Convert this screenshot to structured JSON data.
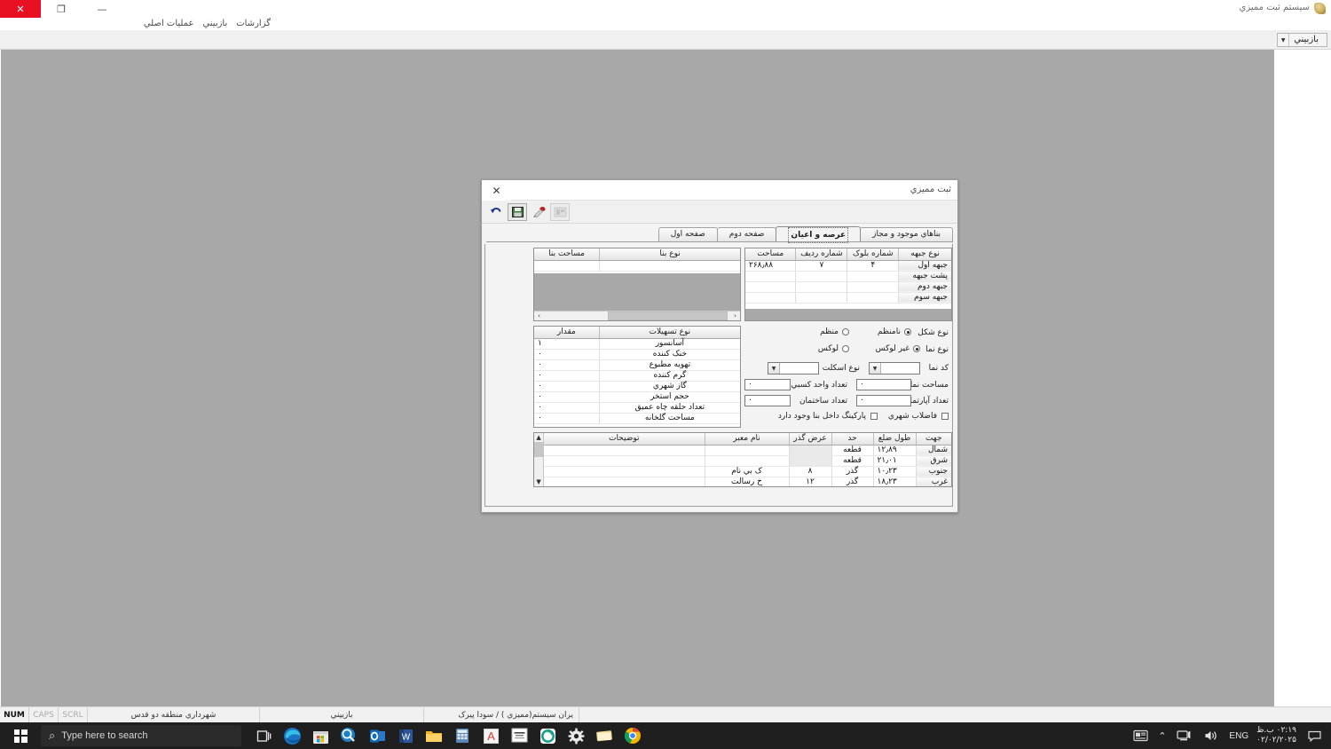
{
  "app": {
    "title": "سیستم ثبت ممیزي",
    "icon": "app-icon",
    "window_controls": {
      "minimize": "—",
      "maximize": "❐",
      "close": "✕"
    },
    "menu": [
      "گزارشات",
      "بازبيني",
      "عملیات اصلي"
    ],
    "toolbar": {
      "button_label": "بازبيني",
      "caret": "▼"
    }
  },
  "dialog": {
    "title": "ثبت ممیزي",
    "close": "✕",
    "toolbar": [
      {
        "name": "undo-icon",
        "glyph": "↶"
      },
      {
        "name": "save-icon",
        "glyph": "💾"
      },
      {
        "name": "edit-stamp-icon",
        "glyph": "✎"
      },
      {
        "name": "preview-icon",
        "glyph": "▦"
      }
    ],
    "tabs": [
      {
        "label": "بناهاي موجود و مجاز",
        "active": false
      },
      {
        "label": "عرصه و اعیان",
        "active": true
      },
      {
        "label": "صفحه دوم",
        "active": false
      },
      {
        "label": "صفحه اول",
        "active": false
      }
    ],
    "building_grid": {
      "headers": [
        "نوع بنا",
        "مساحت بنا"
      ],
      "rows": [
        [
          "",
          ""
        ]
      ],
      "scroll": {
        "left_arrow": "‹",
        "right_arrow": "›"
      }
    },
    "front_grid": {
      "headers": [
        "نوع جبهه",
        "شماره بلوک",
        "شماره ردیف",
        "مساحت"
      ],
      "rows": [
        [
          "جبهه اول",
          "۴",
          "۷",
          "۲۶۸٫۸۸"
        ],
        [
          "پشت جبهه",
          "",
          "",
          ""
        ],
        [
          "جبهه دوم",
          "",
          "",
          ""
        ],
        [
          "جبهه سوم",
          "",
          "",
          ""
        ]
      ]
    },
    "facilities_grid": {
      "headers": [
        "نوع تسهیلات",
        "مقدار"
      ],
      "rows": [
        [
          "آسانسور",
          "۱"
        ],
        [
          "خنک کننده",
          "۰"
        ],
        [
          "تهویه مطبوع",
          "۰"
        ],
        [
          "گرم کننده",
          "۰"
        ],
        [
          "گاز شهري",
          "۰"
        ],
        [
          "حجم استخر",
          "۰"
        ],
        [
          "تعداد حلقه چاه عمیق",
          "۰"
        ],
        [
          "مساحت گلخانه",
          "۰"
        ]
      ]
    },
    "form": {
      "shape_label": "نوع شکل",
      "shape_option_irregular": "نامنظم",
      "shape_option_regular": "منظم",
      "facade_label": "نوع نما",
      "facade_option_nonluxury": "غیر لوکس",
      "facade_option_luxury": "لوکس",
      "facade_code_label": "کد نما",
      "facade_code_value": "",
      "skeleton_label": "نوع اسکلت",
      "skeleton_value": "",
      "facade_area_label": "مساحت نما",
      "facade_area_value": "۰",
      "business_units_label": "تعداد واحد کسبي",
      "business_units_value": "۰",
      "apartments_label": "تعداد آپارتمان",
      "apartments_value": "۰",
      "buildings_label": "تعداد ساختمان",
      "buildings_value": "۰",
      "sewage_label": "فاضلاب شهري",
      "parking_label": "پارکینگ داخل بنا وجود دارد",
      "combo_caret": "▼"
    },
    "boundary_grid": {
      "headers": [
        "جهت",
        "طول ضلع",
        "حد",
        "عرض گذر",
        "نام معبر",
        "توضیحات"
      ],
      "rows": [
        [
          "شمال",
          "۱۲٫۸۹",
          "قطعه",
          "",
          "",
          ""
        ],
        [
          "شرق",
          "۲۱٫۰۱",
          "قطعه",
          "",
          "",
          ""
        ],
        [
          "جنوب",
          "۱۰٫۲۳",
          "گذر",
          "۸",
          "ک بي نام",
          ""
        ],
        [
          "غرب",
          "۱۸٫۲۳",
          "گذر",
          "۱۲",
          "خ رسالت",
          ""
        ]
      ],
      "scroll": {
        "up_arrow": "▲",
        "down_arrow": "▼"
      }
    }
  },
  "statusbar": {
    "num": "NUM",
    "caps": "CAPS",
    "scrl": "SCRL",
    "municipality": "شهرداري منطقه دو قدس",
    "mode": "بازبيني",
    "vendor": "یران سیستم(ممیزي ) / سودا پیرک"
  },
  "taskbar": {
    "search_placeholder": "Type here to search",
    "search_icon": "⌕",
    "task_view_icon": "task-view-icon",
    "apps": [
      {
        "name": "edge-icon",
        "glyph": "e",
        "color": "#1a7fd4"
      },
      {
        "name": "microsoft-store-icon",
        "glyph": "▤",
        "color": "#e8e8e8"
      },
      {
        "name": "search-app-icon",
        "glyph": "🔍",
        "color": "#1f7fc4"
      },
      {
        "name": "outlook-icon",
        "glyph": "O",
        "color": "#0f6cbd"
      },
      {
        "name": "word-icon",
        "glyph": "W",
        "color": "#2b579a"
      },
      {
        "name": "file-explorer-icon",
        "glyph": "▭",
        "color": "#f0b429"
      },
      {
        "name": "excel-calculator-icon",
        "glyph": "▦",
        "color": "#4d7fb3"
      },
      {
        "name": "autocad-icon",
        "glyph": "A",
        "color": "#d73b35"
      },
      {
        "name": "persian-app-icon",
        "glyph": "▤",
        "color": "#ffffff"
      },
      {
        "name": "teams-like-icon",
        "glyph": "◉",
        "color": "#1c9c8a"
      },
      {
        "name": "settings-gear-icon",
        "glyph": "⚙",
        "color": "#e6e6e6"
      },
      {
        "name": "sticky-notes-icon",
        "glyph": "▱",
        "color": "#e8c468"
      },
      {
        "name": "chrome-icon",
        "glyph": "◎",
        "color": "#4caf50"
      }
    ],
    "tray": {
      "news_icon": "news-icon",
      "chevron": "⌃",
      "network_icon": "🖳",
      "volume_icon": "🔊",
      "language": "ENG",
      "time": "۰۲:۱۹ ب.ظ",
      "date": "۰۲/۰۲/۲۰۲۵",
      "notification_icon": "▭"
    }
  },
  "colors": {
    "desktop_gray": "#a8a8a8",
    "dialog_face": "#f3f3f3",
    "taskbar": "#1f1f1f"
  }
}
